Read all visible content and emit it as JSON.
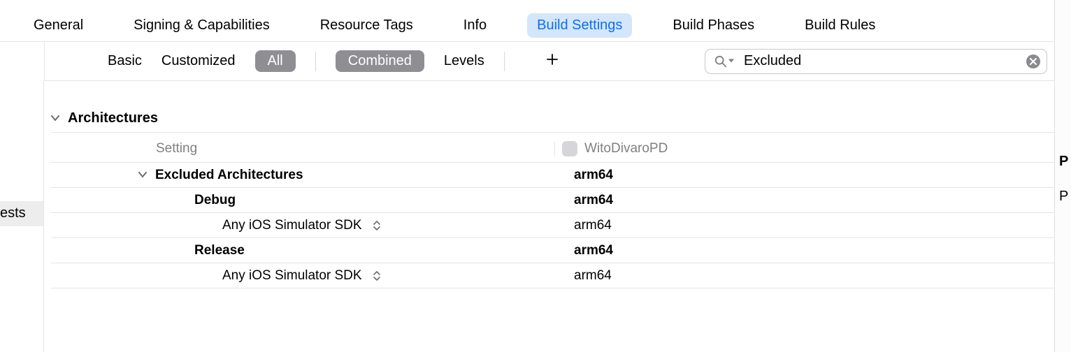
{
  "tabs": {
    "general": "General",
    "signing": "Signing & Capabilities",
    "resource_tags": "Resource Tags",
    "info": "Info",
    "build_settings": "Build Settings",
    "build_phases": "Build Phases",
    "build_rules": "Build Rules"
  },
  "filters": {
    "basic": "Basic",
    "customized": "Customized",
    "all": "All",
    "combined": "Combined",
    "levels": "Levels"
  },
  "search": {
    "value": "Excluded"
  },
  "sidebar": {
    "partial_item": "ests"
  },
  "section": {
    "architectures": "Architectures"
  },
  "columns": {
    "setting": "Setting",
    "target": "WitoDivaroPD"
  },
  "rows": {
    "excluded_arch": {
      "label": "Excluded Architectures",
      "value": "arm64"
    },
    "debug": {
      "label": "Debug",
      "value": "arm64"
    },
    "debug_sdk": {
      "label": "Any iOS Simulator SDK",
      "value": "arm64"
    },
    "release": {
      "label": "Release",
      "value": "arm64"
    },
    "release_sdk": {
      "label": "Any iOS Simulator SDK",
      "value": "arm64"
    }
  },
  "right_panel": {
    "p1": "P",
    "p2": "P"
  }
}
